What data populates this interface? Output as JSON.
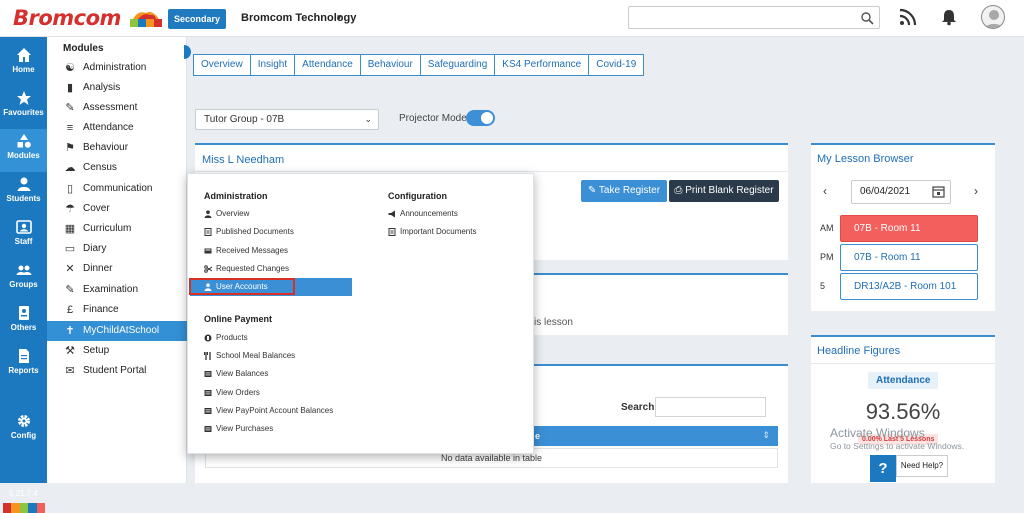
{
  "header": {
    "logo_text": "Bromcom",
    "school_type": "Secondary",
    "school_name": "Bromcom Technology",
    "search_placeholder": "",
    "icons": [
      "search-icon",
      "rss-icon",
      "bell-icon",
      "avatar-icon"
    ],
    "colors": {
      "logo": "#d4312e",
      "badge": "#1f7abf"
    }
  },
  "nav": {
    "items": [
      {
        "label": "Home",
        "icon": "home-icon"
      },
      {
        "label": "Favourites",
        "icon": "star-icon"
      },
      {
        "label": "Modules",
        "icon": "shapes-icon"
      },
      {
        "label": "Students",
        "icon": "student-icon"
      },
      {
        "label": "Staff",
        "icon": "staff-icon"
      },
      {
        "label": "Groups",
        "icon": "groups-icon"
      },
      {
        "label": "Others",
        "icon": "others-icon"
      },
      {
        "label": "Reports",
        "icon": "reports-icon"
      },
      {
        "label": "Config",
        "icon": "gear-icon"
      }
    ],
    "active": "Modules",
    "version": "5.21.7.4"
  },
  "modules": {
    "title": "Modules",
    "items": [
      {
        "label": "Administration",
        "icon": "users-icon"
      },
      {
        "label": "Analysis",
        "icon": "bar-chart-icon"
      },
      {
        "label": "Assessment",
        "icon": "pen-icon"
      },
      {
        "label": "Attendance",
        "icon": "checklist-icon"
      },
      {
        "label": "Behaviour",
        "icon": "megaphone-icon"
      },
      {
        "label": "Census",
        "icon": "cloud-upload-icon"
      },
      {
        "label": "Communication",
        "icon": "mobile-icon"
      },
      {
        "label": "Cover",
        "icon": "umbrella-icon"
      },
      {
        "label": "Curriculum",
        "icon": "grid-icon"
      },
      {
        "label": "Diary",
        "icon": "book-icon"
      },
      {
        "label": "Dinner",
        "icon": "cutlery-icon"
      },
      {
        "label": "Examination",
        "icon": "exam-icon"
      },
      {
        "label": "Finance",
        "icon": "pound-icon"
      },
      {
        "label": "MyChildAtSchool",
        "icon": "child-icon"
      },
      {
        "label": "Setup",
        "icon": "wrench-icon"
      },
      {
        "label": "Student Portal",
        "icon": "chat-icon"
      }
    ],
    "active": "MyChildAtSchool"
  },
  "tabs": [
    "Overview",
    "Insight",
    "Attendance",
    "Behaviour",
    "Safeguarding",
    "KS4 Performance",
    "Covid-19"
  ],
  "filters": {
    "tutor_group": "Tutor Group - 07B",
    "projector_label": "Projector Mode",
    "projector_on": true
  },
  "teacher_panel": {
    "name": "Miss L Needham",
    "take_register": "Take Register",
    "print_register": "Print Blank Register"
  },
  "lesson_panel": {
    "note": "is lesson"
  },
  "table_panel": {
    "search_label": "Search:",
    "search_value": "",
    "header_fragment": "e",
    "empty_message": "No data available in table"
  },
  "lesson_browser": {
    "title": "My Lesson Browser",
    "date": "06/04/2021",
    "periods": [
      {
        "label": "AM",
        "lesson": "07B - Room 11",
        "current": true
      },
      {
        "label": "PM",
        "lesson": "07B - Room 11",
        "current": false
      },
      {
        "label": "5",
        "lesson": "DR13/A2B - Room 101",
        "current": false
      }
    ]
  },
  "headline": {
    "title": "Headline Figures",
    "attendance_label": "Attendance",
    "attendance_value": "93.56%",
    "badge": "0.00% Last 5 Lessons"
  },
  "help": {
    "icon": "?",
    "label": "Need Help?"
  },
  "watermark": {
    "title": "Activate Windows",
    "subtitle": "Go to Settings to activate Windows."
  },
  "dropdown": {
    "administration": {
      "heading": "Administration",
      "items": [
        {
          "label": "Overview",
          "icon": "user-icon"
        },
        {
          "label": "Published Documents",
          "icon": "document-icon"
        },
        {
          "label": "Received Messages",
          "icon": "inbox-icon"
        },
        {
          "label": "Requested Changes",
          "icon": "scissors-icon"
        },
        {
          "label": "User Accounts",
          "icon": "user-icon"
        }
      ]
    },
    "configuration": {
      "heading": "Configuration",
      "items": [
        {
          "label": "Announcements",
          "icon": "bullhorn-icon"
        },
        {
          "label": "Important Documents",
          "icon": "document-icon"
        }
      ]
    },
    "online_payment": {
      "heading": "Online Payment",
      "items": [
        {
          "label": "Products",
          "icon": "products-icon"
        },
        {
          "label": "School Meal Balances",
          "icon": "cutlery-icon"
        },
        {
          "label": "View Balances",
          "icon": "list-icon"
        },
        {
          "label": "View Orders",
          "icon": "list-icon"
        },
        {
          "label": "View PayPoint Account Balances",
          "icon": "list-icon"
        },
        {
          "label": "View Purchases",
          "icon": "list-icon"
        }
      ]
    },
    "highlighted": "User Accounts"
  }
}
